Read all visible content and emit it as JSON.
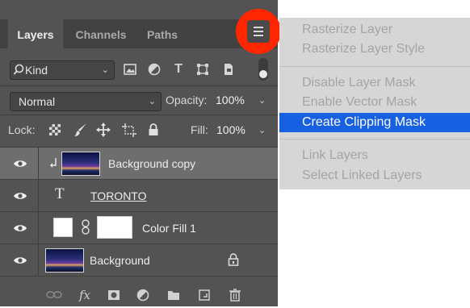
{
  "tabs": [
    {
      "label": "Layers",
      "active": true
    },
    {
      "label": "Channels",
      "active": false
    },
    {
      "label": "Paths",
      "active": false
    }
  ],
  "filter": {
    "kind_label": "Kind",
    "icons": [
      "image-filter-icon",
      "adjustment-filter-icon",
      "type-filter-icon",
      "shape-filter-icon",
      "smart-object-filter-icon"
    ]
  },
  "blend": {
    "mode": "Normal",
    "opacity_label": "Opacity:",
    "opacity_value": "100%"
  },
  "lock": {
    "label": "Lock:",
    "fill_label": "Fill:",
    "fill_value": "100%"
  },
  "layers": [
    {
      "name": "Background copy",
      "type": "photo",
      "clipped": true,
      "selected": true,
      "visible": true
    },
    {
      "name": "TORONTO",
      "type": "text",
      "selected": false,
      "visible": true
    },
    {
      "name": "Color Fill 1",
      "type": "fill",
      "selected": false,
      "visible": true
    },
    {
      "name": "Background",
      "type": "photo",
      "locked": true,
      "selected": false,
      "visible": true
    }
  ],
  "menu": {
    "groups": [
      [
        "Rasterize Layer",
        "Rasterize Layer Style"
      ],
      [
        "Disable Layer Mask",
        "Enable Vector Mask",
        "Create Clipping Mask"
      ],
      [
        "Link Layers",
        "Select Linked Layers"
      ]
    ],
    "highlighted": "Create Clipping Mask"
  },
  "colors": {
    "panel_bg": "#535353",
    "highlight": "#1760e2",
    "annotation": "#ff2600",
    "menu_bg": "#d6d6d6"
  }
}
